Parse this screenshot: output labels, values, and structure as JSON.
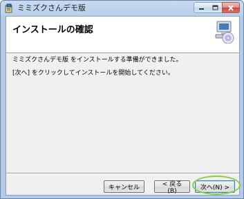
{
  "window": {
    "title": "ミミズクさんデモ版"
  },
  "header": {
    "title": "インストールの確認"
  },
  "body": {
    "line1": "ミミズクさんデモ版 をインストールする準備ができました。",
    "line2": "[次へ] をクリックしてインストールを開始してください。"
  },
  "buttons": {
    "cancel": "キャンセル",
    "back": "< 戻る(B)",
    "next": "次へ(N) >"
  },
  "icons": {
    "app": "installer-app-icon",
    "setup": "cd-computer-setup-icon",
    "minimize": "minimize-icon",
    "maximize": "maximize-icon",
    "close": "close-icon"
  },
  "colors": {
    "highlight": "#8ccc3c"
  }
}
